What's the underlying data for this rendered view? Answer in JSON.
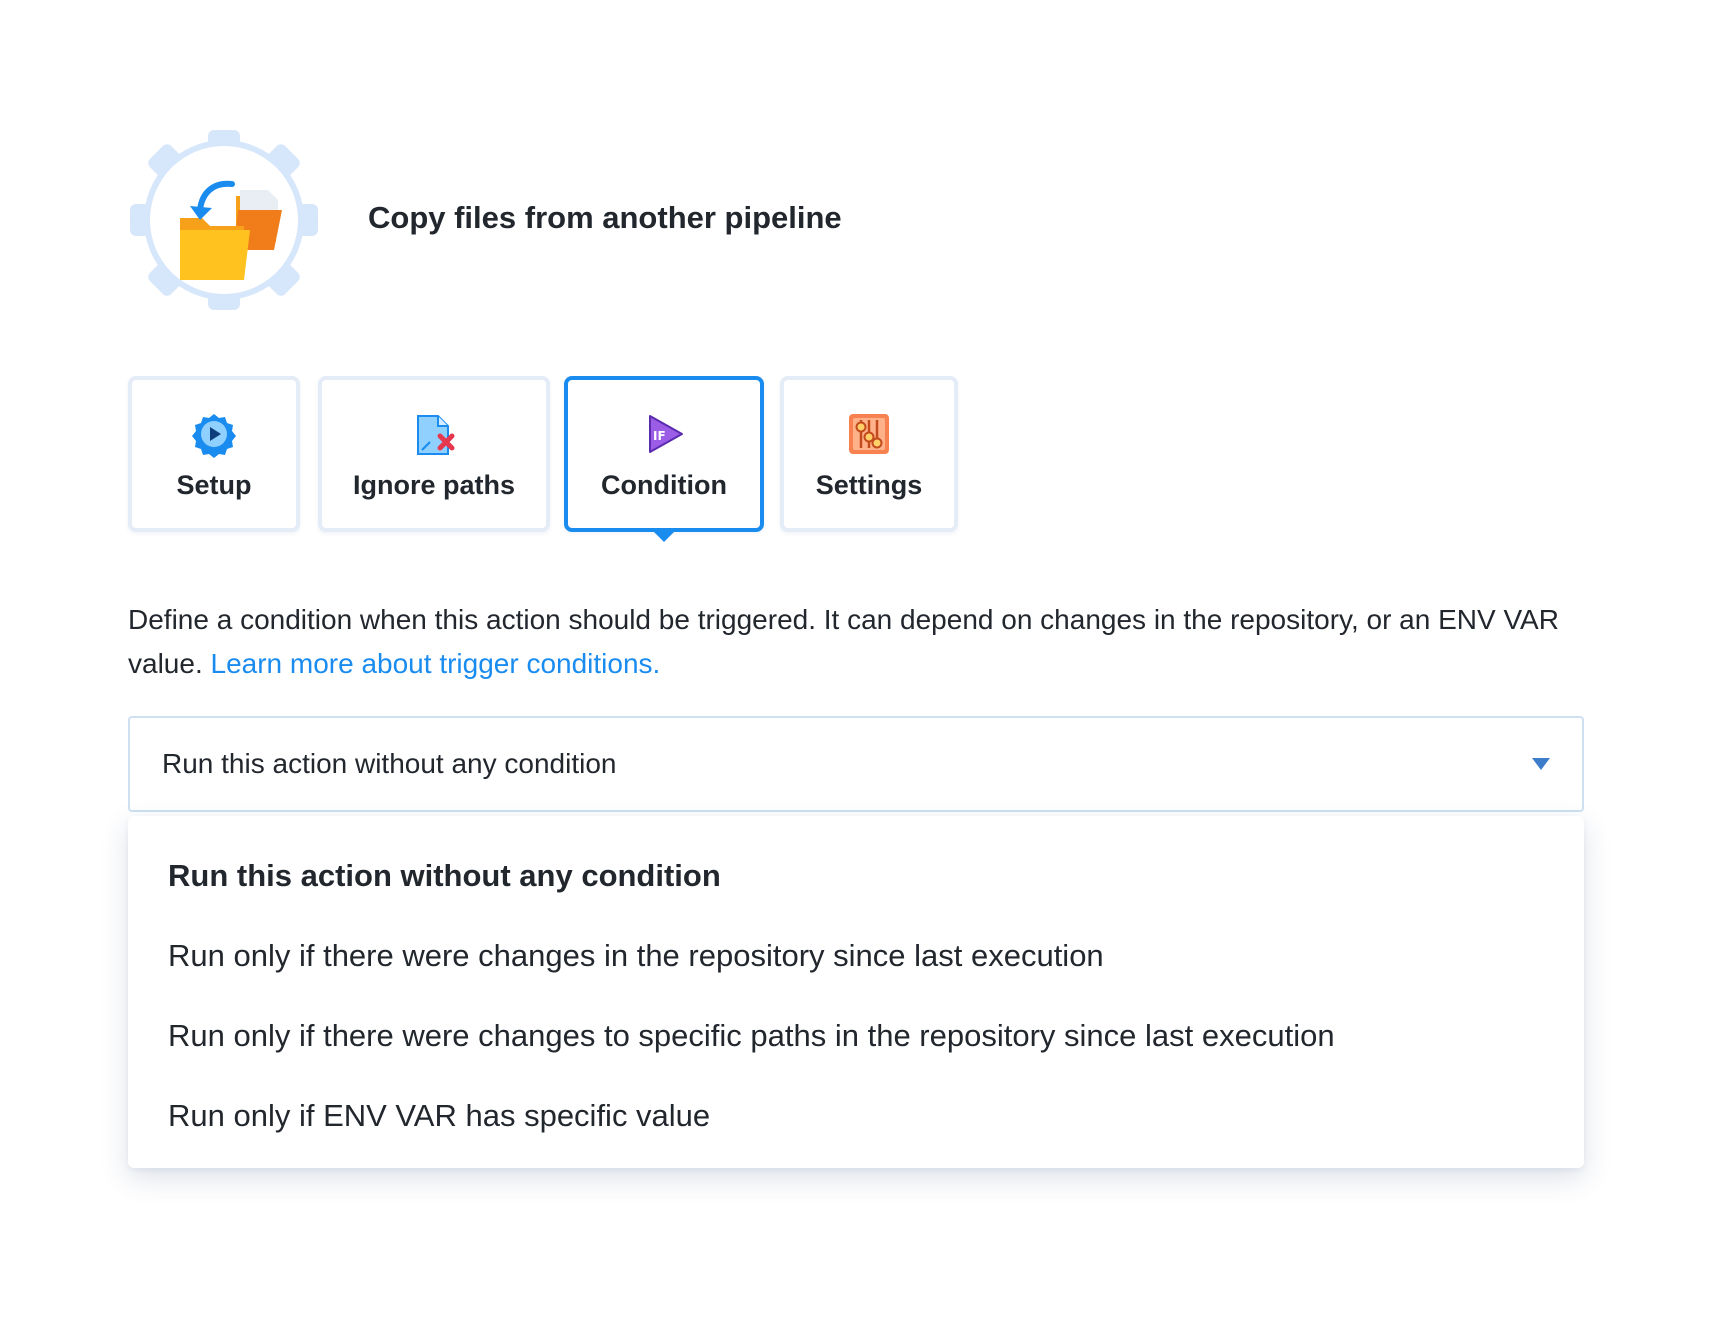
{
  "action": {
    "title": "Copy files from another pipeline",
    "icon": "copy-files-icon",
    "badge_color": "#d6e7fb"
  },
  "tabs": [
    {
      "label": "Setup",
      "icon": "setup-gear-icon",
      "active": false
    },
    {
      "label": "Ignore paths",
      "icon": "ignore-paths-icon",
      "active": false
    },
    {
      "label": "Condition",
      "icon": "condition-if-icon",
      "active": true
    },
    {
      "label": "Settings",
      "icon": "settings-sliders-icon",
      "active": false
    }
  ],
  "description": {
    "text": "Define a condition when this action should be triggered. It can depend on changes in the repository, or an ENV VAR value.",
    "link_text": "Learn more about trigger conditions."
  },
  "condition_select": {
    "value": "Run this action without any condition",
    "options": [
      "Run this action without any condition",
      "Run only if there were changes in the repository since last execution",
      "Run only if there were changes to specific paths in the repository since last execution",
      "Run only if ENV VAR has specific value"
    ],
    "selected_index": 0
  },
  "colors": {
    "accent": "#1a8cf0",
    "tab_border": "#e3ecf7",
    "text": "#22272e"
  }
}
